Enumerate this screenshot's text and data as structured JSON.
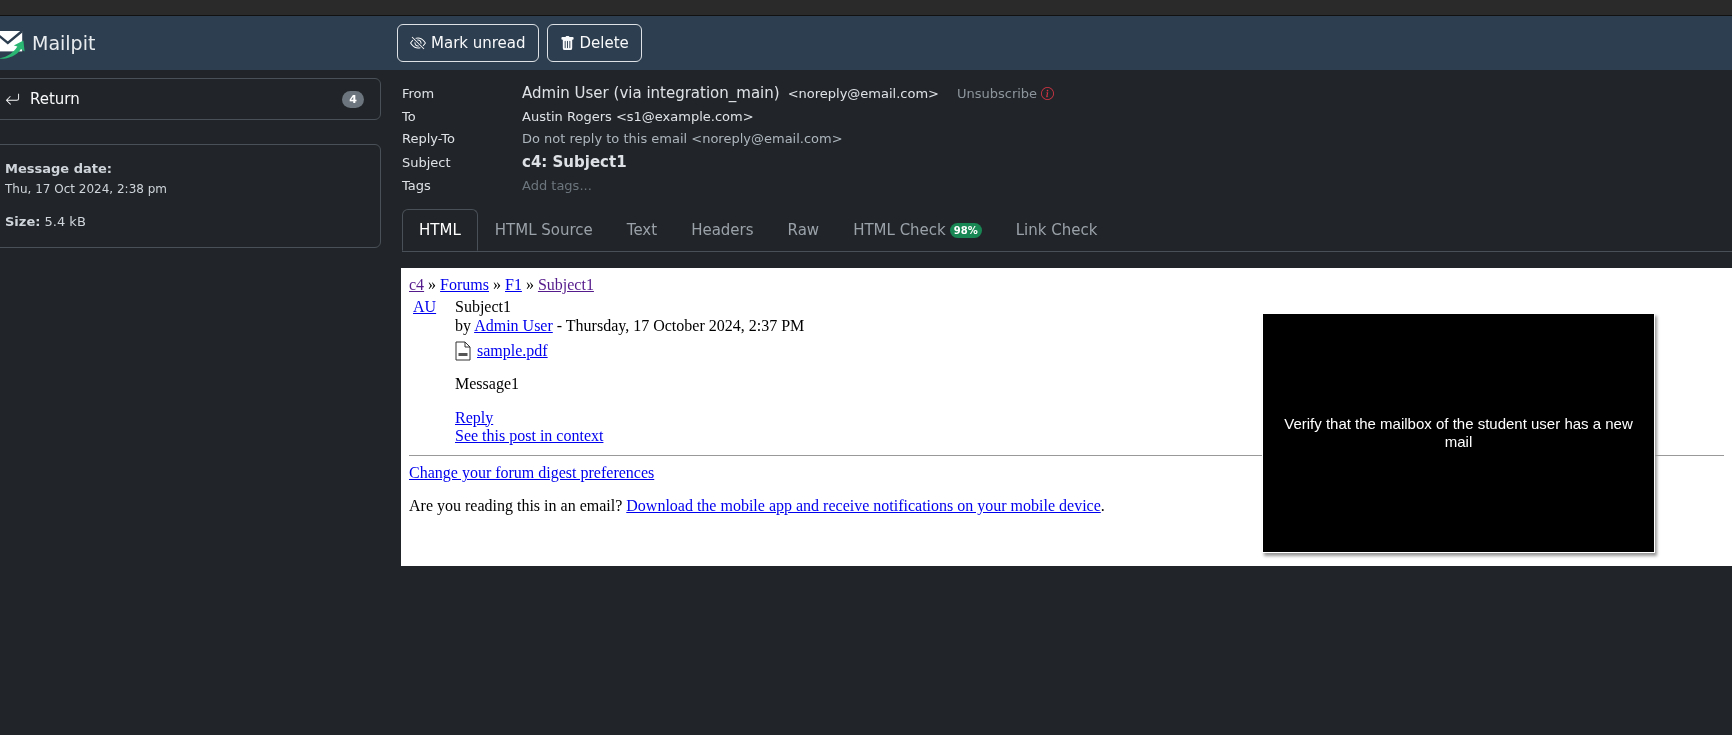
{
  "app": {
    "name": "Mailpit"
  },
  "toolbar": {
    "buttons": [
      {
        "label": "Mark unread",
        "kind": "mark_unread"
      },
      {
        "label": "Delete",
        "kind": "delete"
      }
    ]
  },
  "sidebar": {
    "return_button": {
      "label": "Return",
      "count": "4"
    },
    "info": [
      {
        "label": "Message date:",
        "value": "Thu, 17 Oct 2024, 2:38 pm",
        "kind": "stacked"
      },
      {
        "label": "Size:",
        "value": "5.4 kB",
        "kind": "inline"
      }
    ]
  },
  "headers": [
    {
      "label": "From",
      "kind": "from",
      "value": "Admin User (via integration_main)",
      "address": "<noreply@email.com>",
      "action": "Unsubscribe"
    },
    {
      "label": "To",
      "kind": "plain",
      "value": "Austin Rogers <s1@example.com>"
    },
    {
      "label": "Reply-To",
      "kind": "muted",
      "value": "Do not reply to this email <noreply@email.com>"
    },
    {
      "label": "Subject",
      "kind": "subject",
      "value": "c4: Subject1"
    },
    {
      "label": "Tags",
      "kind": "tags",
      "placeholder": "Add tags..."
    }
  ],
  "tabs": [
    {
      "label": "HTML",
      "selected": true
    },
    {
      "label": "HTML Source",
      "selected": false
    },
    {
      "label": "Text",
      "selected": false
    },
    {
      "label": "Headers",
      "selected": false
    },
    {
      "label": "Raw",
      "selected": false
    },
    {
      "label": "HTML Check",
      "selected": false,
      "badge": "98%"
    },
    {
      "label": "Link Check",
      "selected": false
    }
  ],
  "email": {
    "separator": "»",
    "breadcrumbs": [
      {
        "text": "c4",
        "visited": true
      },
      {
        "text": "Forums",
        "visited": false
      },
      {
        "text": "F1",
        "visited": false
      },
      {
        "text": "Subject1",
        "visited": true
      }
    ],
    "post": {
      "avatar_link": "AU",
      "title": "Subject1",
      "by": "by",
      "author": "Admin User",
      "date": "- Thursday, 17 October 2024, 2:37 PM",
      "attachment": "sample.pdf",
      "message": "Message1",
      "links": [
        "Reply",
        "See this post in context"
      ]
    },
    "footer_link": "Change your forum digest preferences",
    "closing": {
      "text": "Are you reading this in an email?",
      "link": "Download the mobile app and receive notifications on your mobile device",
      "suffix": "."
    }
  },
  "overlay": {
    "text": "Verify that the mailbox of the student user has a new mail"
  }
}
